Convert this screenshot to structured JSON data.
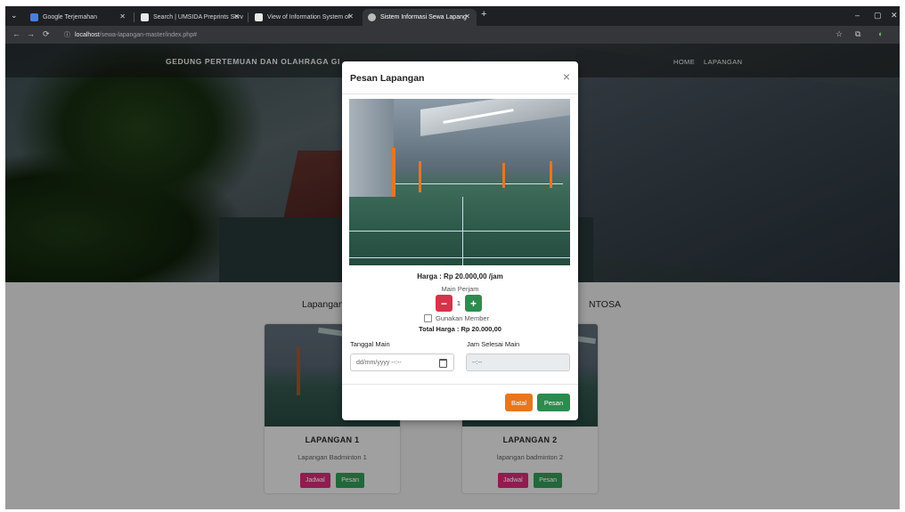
{
  "browser": {
    "tabs": [
      {
        "label": "Google Terjemahan",
        "fav_color": "#4a7fd8",
        "active": false
      },
      {
        "label": "Search | UMSIDA Preprints Serv",
        "fav_color": "#e8e8e8",
        "active": false
      },
      {
        "label": "View of Information System of",
        "fav_color": "#e8e8e8",
        "active": false
      },
      {
        "label": "Sistem Informasi Sewa Lapang",
        "fav_color": "#bbbbbb",
        "active": true
      }
    ],
    "new_tab": "+",
    "url_host": "localhost",
    "url_path": "/sewa-lapangan-master/index.php#",
    "minimize": "–",
    "maximize": "▢",
    "close": "✕",
    "back": "←",
    "forward": "→",
    "reload": "⟳",
    "site_info": "ⓘ",
    "bookmark": "☆",
    "extensions": "⧉",
    "profile": "◐",
    "tab_close": "✕",
    "tab_menu": "⌄"
  },
  "site": {
    "brand": "GEDUNG PERTEMUAN DAN OLAHRAGA GI",
    "menu": [
      "HOME",
      "LAPANGAN"
    ],
    "section_title_left": "Lapangan",
    "section_title_right": "NTOSA",
    "cards": [
      {
        "title": "LAPANGAN 1",
        "desc": "Lapangan Badminton 1",
        "btn_schedule": "Jadwal",
        "btn_book": "Pesan"
      },
      {
        "title": "LAPANGAN 2",
        "desc": "lapangan badminton 2",
        "btn_schedule": "Jadwal",
        "btn_book": "Pesan"
      }
    ]
  },
  "modal": {
    "title": "Pesan Lapangan",
    "close": "×",
    "price": "Harga : Rp 20.000,00 /jam",
    "hours_label": "Main Perjam",
    "minus": "−",
    "qty": "1",
    "plus": "+",
    "member_label": "Gunakan Member",
    "total": "Total Harga : Rp 20.000,00",
    "date_label": "Tanggal Main",
    "date_placeholder": "dd/mm/yyyy --:--",
    "end_label": "Jam Selesai Main",
    "end_placeholder": "--:--",
    "cancel": "Batal",
    "submit": "Pesan"
  },
  "colors": {
    "danger": "#d6334a",
    "success": "#2e8b4e",
    "warning": "#e8761c",
    "pink": "#c2266a"
  }
}
